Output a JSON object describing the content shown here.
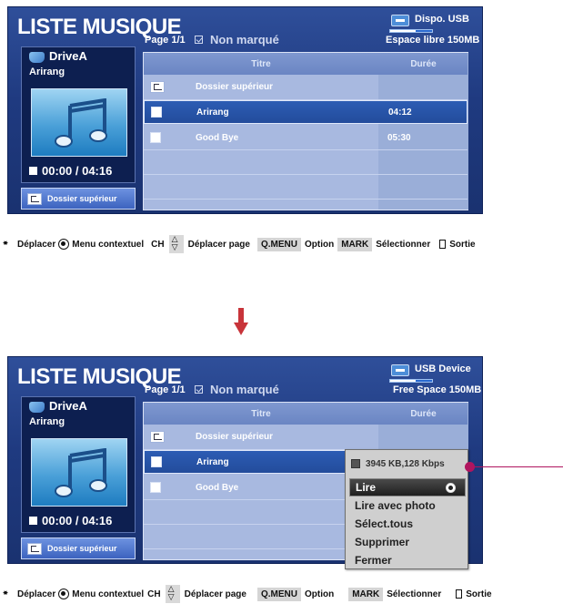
{
  "screen_before": {
    "title": "LISTE MUSIQUE",
    "page": "Page 1/1",
    "unmarked": "Non marqué",
    "usb": {
      "device": "Dispo. USB",
      "free_space": "Espace libre 150MB",
      "used_fraction": 0.6
    },
    "drive": {
      "name": "DriveA",
      "track": "Arirang",
      "time": "00:00 / 04:16"
    },
    "up_button": "Dossier supérieur",
    "table": {
      "col_title": "Titre",
      "col_duration": "Durée",
      "rows": [
        {
          "title": "Dossier supérieur",
          "duration": ""
        },
        {
          "title": "Arirang",
          "duration": "04:12"
        },
        {
          "title": "Good Bye",
          "duration": "05:30"
        }
      ]
    }
  },
  "screen_after": {
    "title": "LISTE MUSIQUE",
    "page": "Page 1/1",
    "unmarked": "Non marqué",
    "usb": {
      "device": "USB Device",
      "free_space": "Free Space 150MB",
      "used_fraction": 0.6
    },
    "drive": {
      "name": "DriveA",
      "track": "Arirang",
      "time": "00:00 / 04:16"
    },
    "up_button": "Dossier supérieur",
    "table": {
      "col_title": "Titre",
      "col_duration": "Durée",
      "rows": [
        {
          "title": "Dossier supérieur",
          "duration": ""
        },
        {
          "title": "Arirang",
          "duration": ""
        },
        {
          "title": "Good Bye",
          "duration": ""
        }
      ]
    },
    "context_menu": {
      "info": "3945 KB,128 Kbps",
      "items": [
        "Lire",
        "Lire avec photo",
        "Sélect.tous",
        "Supprimer",
        "Fermer"
      ]
    }
  },
  "help_top": {
    "move": "Déplacer",
    "context": "Menu contextuel",
    "ch": "CH",
    "page_move": "Déplacer page",
    "qmenu": "Q.MENU",
    "option": "Option",
    "mark": "MARK",
    "select": "Sélectionner",
    "exit": "Sortie"
  },
  "help_bottom": {
    "move": "Déplacer",
    "context": "Menu contextuel",
    "ch": "CH",
    "page_move": "Déplacer page",
    "qmenu": "Q.MENU",
    "option": "Option",
    "mark": "MARK",
    "select": "Sélectionner",
    "exit": "Sortie"
  },
  "icons": {
    "arrow": "down-arrow-icon",
    "drive": "drive-icon",
    "usb": "usb-icon",
    "note": "music-note-icon"
  },
  "colors": {
    "panel": "#1f3a80",
    "selected_row": "#2c5cb4",
    "arrow": "#c8343a",
    "callout": "#b0155f"
  }
}
